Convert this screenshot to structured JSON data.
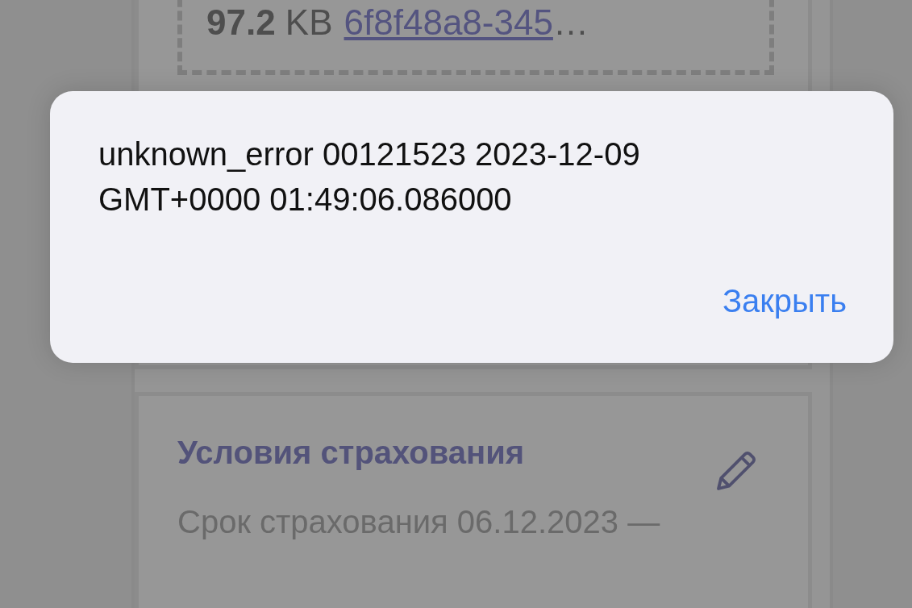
{
  "file_box": {
    "size_value": "97.2",
    "size_unit": "KB",
    "file_link": "6f8f48a8-345",
    "ellipsis": "…"
  },
  "insurance_card": {
    "title": "Условия страхования",
    "period": "Срок страхования 06.12.2023 —"
  },
  "dialog": {
    "message": "unknown_error 00121523 2023-12-09 GMT+0000 01:49:06.086000",
    "close_button": "Закрыть"
  }
}
